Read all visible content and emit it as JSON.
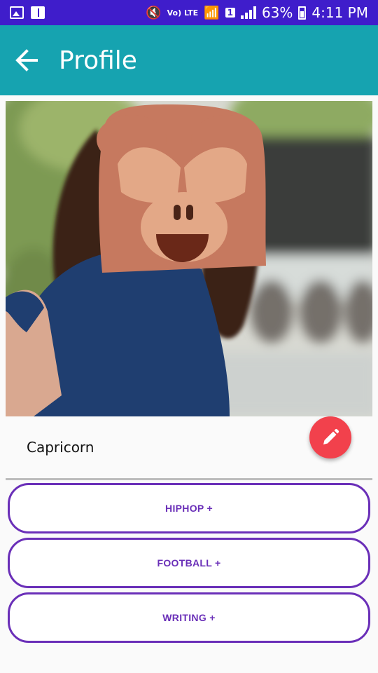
{
  "status_bar": {
    "volte_label": "Vo) LTE",
    "sim_label": "1",
    "battery": "63%",
    "time": "4:11 PM"
  },
  "app_bar": {
    "title": "Profile",
    "back_icon": "arrow-left-icon"
  },
  "profile": {
    "zodiac": "Capricorn",
    "edit_icon": "pencil-icon"
  },
  "interests": [
    {
      "label": "HIPHOP +"
    },
    {
      "label": "FOOTBALL +"
    },
    {
      "label": "WRITING +"
    }
  ],
  "colors": {
    "status_bar": "#3f1dcb",
    "app_bar": "#16a3b0",
    "fab": "#f2414c",
    "interest_accent": "#6a2fb8"
  }
}
